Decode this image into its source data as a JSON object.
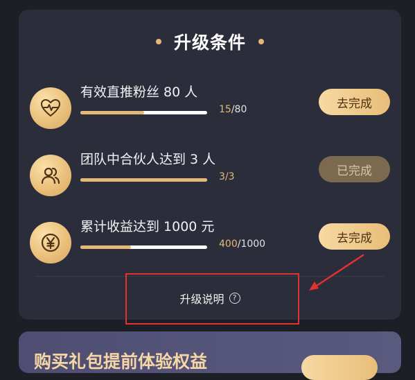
{
  "section": {
    "title": "升级条件"
  },
  "conditions": [
    {
      "icon": "heart-pulse-icon",
      "label": "有效直推粉丝 80 人",
      "current": "15",
      "target": "/80",
      "fraction": 0.5,
      "action": "去完成",
      "completed": false
    },
    {
      "icon": "users-icon",
      "label": "团队中合伙人达到 3 人",
      "current": "3",
      "target": "/3",
      "fraction": 1.0,
      "action": "已完成",
      "completed": true
    },
    {
      "icon": "yen-icon",
      "label": "累计收益达到 1000 元",
      "current": "400",
      "target": "/1000",
      "fraction": 0.4,
      "action": "去完成",
      "completed": false
    }
  ],
  "footer": {
    "explain_label": "升级说明",
    "help_glyph": "?"
  },
  "promo": {
    "title": "购买礼包提前体验权益"
  },
  "colors": {
    "accent": "#e3b978",
    "card_bg": "#2c2d3a",
    "page_bg": "#1e1e27",
    "annotation": "#e2322f"
  }
}
